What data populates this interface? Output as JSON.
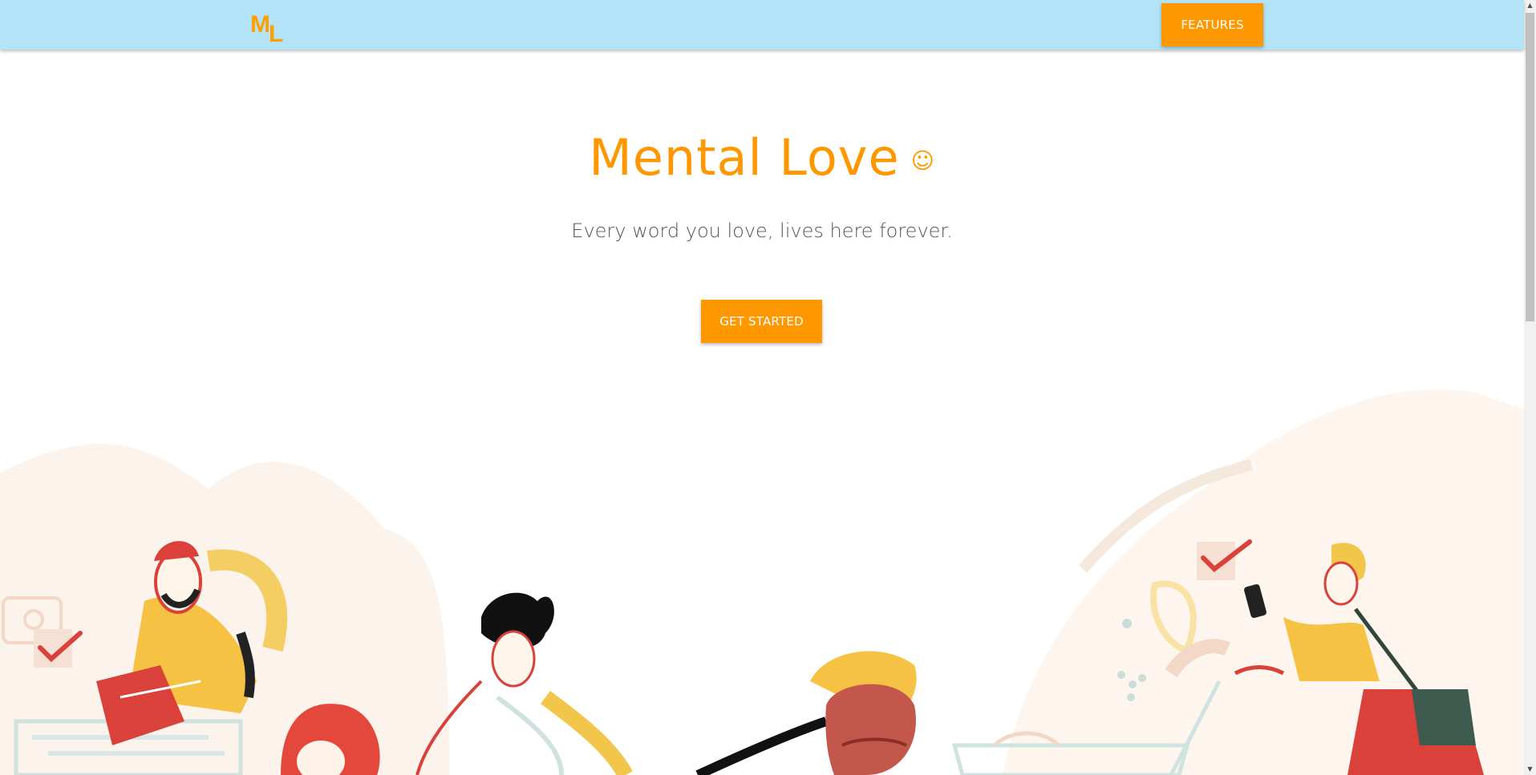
{
  "nav": {
    "logo_letter_1": "M",
    "logo_letter_2": "L",
    "features_label": "FEATURES"
  },
  "hero": {
    "title": "Mental Love",
    "emoji": "☺",
    "subtitle": "Every word you love, lives here forever.",
    "cta_label": "GET STARTED"
  },
  "colors": {
    "accent": "#ff9800",
    "navbar": "#b2e3f7"
  },
  "icons": {
    "scroll_up": "▲",
    "scroll_down": "▼"
  }
}
